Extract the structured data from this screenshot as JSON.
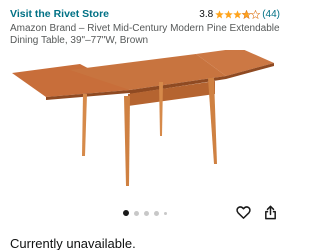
{
  "header": {
    "store_link": "Visit the Rivet Store",
    "rating_value": "3.8",
    "rating_stars": 3.8,
    "rating_count": "(44)"
  },
  "product": {
    "title": "Amazon Brand – Rivet Mid-Century Modern Pine Extendable Dining Table, 39\"–77\"W, Brown",
    "image_icon": "extendable-dining-table-photo"
  },
  "carousel": {
    "total": 5,
    "active_index": 0
  },
  "actions": {
    "wishlist_icon": "heart-outline-icon",
    "share_icon": "share-icon"
  },
  "availability": {
    "text": "Currently unavailable."
  },
  "colors": {
    "link": "#007185",
    "star": "#ffa41c",
    "text": "#0f1111"
  }
}
